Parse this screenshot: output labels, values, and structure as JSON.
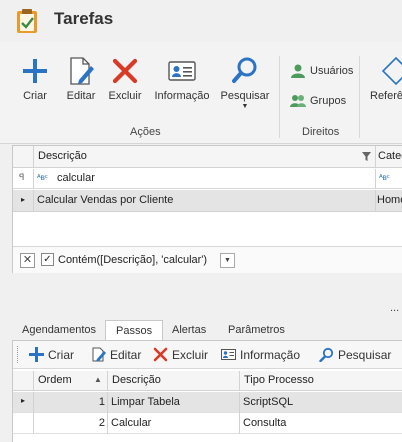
{
  "window": {
    "title": "Tarefas"
  },
  "ribbon": {
    "groups": {
      "acoes": "Ações",
      "direitos": "Direitos"
    },
    "buttons": {
      "criar": "Criar",
      "editar": "Editar",
      "excluir": "Excluir",
      "informacao": "Informação",
      "pesquisar": "Pesquisar",
      "usuarios": "Usuários",
      "grupos": "Grupos",
      "referencia": "Referê"
    }
  },
  "grid": {
    "columns": [
      "Descrição",
      "Categ"
    ],
    "filter": {
      "descricao": "calcular",
      "categoria": ""
    },
    "rows": [
      {
        "descricao": "Calcular Vendas por Cliente",
        "categoria": "Homo"
      }
    ],
    "filter_expression": "Contém([Descrição], 'calcular')"
  },
  "ellipsis": "...",
  "tabs": [
    "Agendamentos",
    "Passos",
    "Alertas",
    "Parâmetros"
  ],
  "active_tab": "Passos",
  "steps_toolbar": {
    "criar": "Criar",
    "editar": "Editar",
    "excluir": "Excluir",
    "informacao": "Informação",
    "pesquisar": "Pesquisar"
  },
  "steps_grid": {
    "columns": [
      "Ordem",
      "Descrição",
      "Tipo Processo"
    ],
    "rows": [
      {
        "ordem": "1",
        "descricao": "Limpar Tabela",
        "tipo": "ScriptSQL"
      },
      {
        "ordem": "2",
        "descricao": "Calcular",
        "tipo": "Consulta"
      }
    ]
  },
  "colors": {
    "accent_blue": "#2b73c5",
    "delete_red": "#d93a26",
    "user_green": "#4e9a5c",
    "title_icon_orange": "#e89a2c"
  }
}
